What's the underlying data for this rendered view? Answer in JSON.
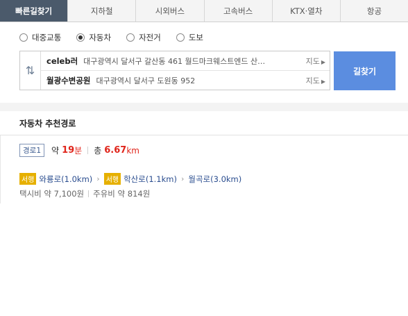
{
  "tabs": [
    {
      "label": "빠른길찾기",
      "active": true
    },
    {
      "label": "지하철",
      "active": false
    },
    {
      "label": "시외버스",
      "active": false
    },
    {
      "label": "고속버스",
      "active": false
    },
    {
      "label": "KTX·열차",
      "active": false
    },
    {
      "label": "항공",
      "active": false
    }
  ],
  "modes": [
    {
      "label": "대중교통",
      "selected": false
    },
    {
      "label": "자동차",
      "selected": true
    },
    {
      "label": "자전거",
      "selected": false
    },
    {
      "label": "도보",
      "selected": false
    }
  ],
  "route": {
    "swap_icon": "swap-vertical-icon",
    "from": {
      "name": "celeb러",
      "address": "대구광역시 달서구 갈산동 461 월드마크웨스트엔드 산…",
      "map_label": "지도"
    },
    "to": {
      "name": "월광수변공원",
      "address": "대구광역시 달서구 도원동 952",
      "map_label": "지도"
    },
    "search_label": "길찾기"
  },
  "result": {
    "section_title": "자동차 추천경로",
    "route_label": "경로1",
    "time_prefix": "약",
    "time_value": "19",
    "time_unit": "분",
    "distance_prefix": "총",
    "distance_value": "6.67",
    "distance_unit": "km",
    "roads": [
      {
        "badge": "서행",
        "name": "와룡로(1.0km)"
      },
      {
        "badge": "서행",
        "name": "학산로(1.1km)"
      },
      {
        "badge": "",
        "name": "월곡로(3.0km)"
      }
    ],
    "taxi_fare": "택시비 약 7,100원",
    "fuel_cost": "주유비 약 814원"
  },
  "colors": {
    "active_tab": "#4b5a6b",
    "search_button": "#5b8de0",
    "highlight": "#e0251b",
    "slow_badge": "#e6b000"
  }
}
